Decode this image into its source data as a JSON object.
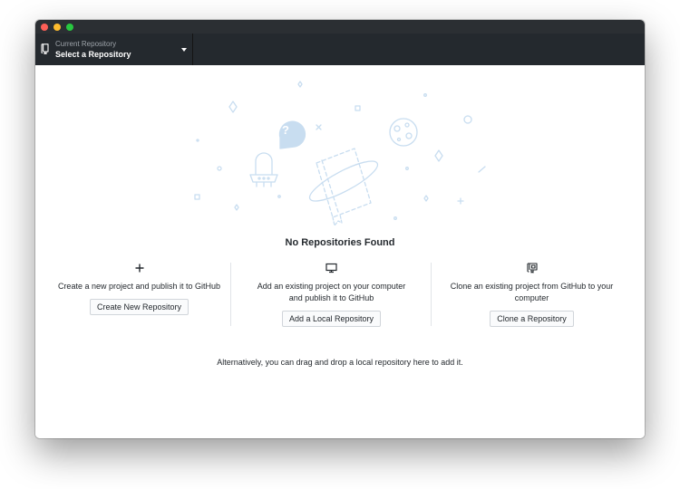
{
  "window": {
    "traffic_lights": [
      "close",
      "minimize",
      "zoom"
    ]
  },
  "toolbar": {
    "repo_caption": "Current Repository",
    "repo_title": "Select a Repository",
    "repo_icon": "repo-icon",
    "dropdown_icon": "caret-down-icon"
  },
  "empty_state": {
    "heading": "No Repositories Found",
    "actions": [
      {
        "icon": "plus-icon",
        "text": "Create a new project and publish it to GitHub",
        "button": "Create New Repository"
      },
      {
        "icon": "monitor-icon",
        "text": "Add an existing project on your computer and publish it to GitHub",
        "button": "Add a Local Repository"
      },
      {
        "icon": "repo-clone-icon",
        "text": "Clone an existing project from GitHub to your computer",
        "button": "Clone a Repository"
      }
    ],
    "footer": "Alternatively, you can drag and drop a local repository here to add it."
  },
  "colors": {
    "toolbar": "#24292e",
    "illustration": "#c8ddf0",
    "text": "#24292e"
  }
}
